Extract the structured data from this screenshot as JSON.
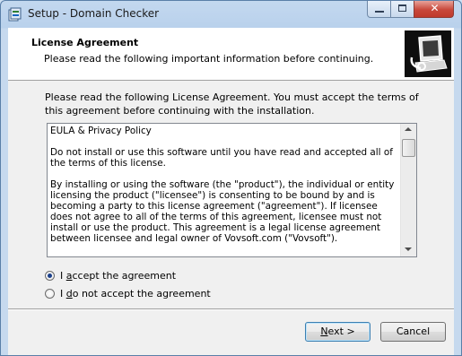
{
  "window": {
    "title": "Setup - Domain Checker",
    "controls": {
      "close_glyph": "✕"
    }
  },
  "header": {
    "title": "License Agreement",
    "subtitle": "Please read the following important information before continuing."
  },
  "intro": "Please read the following License Agreement. You must accept the terms of this agreement before continuing with the installation.",
  "license_text": "EULA & Privacy Policy\n\nDo not install or use this software until you have read and accepted all of the terms of this license.\n\nBy installing or using the software (the \"product\"), the individual or entity licensing the product (\"licensee\") is consenting to be bound by and is becoming a party to this license agreement (\"agreement\"). If licensee does not agree to all of the terms of this agreement, licensee must not install or use the product. This agreement is a legal license agreement between licensee and legal owner of Vovsoft.com (\"Vovsoft\").",
  "options": {
    "accept": {
      "prefix": "I ",
      "hotkey": "a",
      "rest": "ccept the agreement",
      "selected": true
    },
    "decline": {
      "prefix": "I ",
      "hotkey": "d",
      "rest": "o not accept the agreement",
      "selected": false
    }
  },
  "buttons": {
    "next": {
      "hotkey": "N",
      "rest": "ext >"
    },
    "cancel": "Cancel"
  },
  "icons": {
    "app": "setup-icon",
    "header": "computer-icon",
    "minimize": "minimize-icon",
    "maximize": "maximize-icon",
    "close": "close-icon"
  },
  "colors": {
    "default_button_border": "#3c7fb1",
    "close_button": "#c8483b"
  }
}
